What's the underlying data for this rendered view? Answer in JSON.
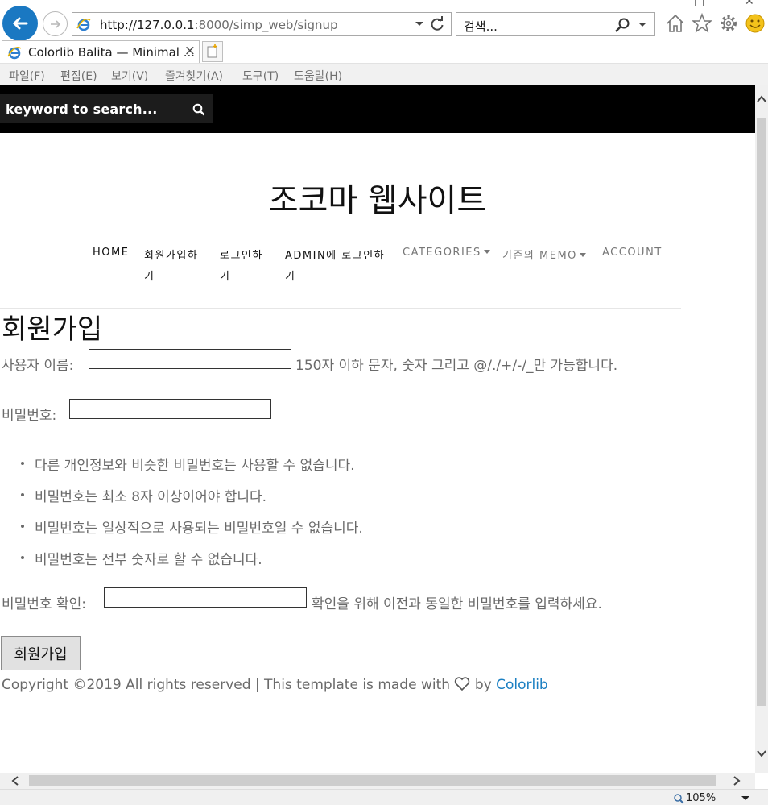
{
  "browser": {
    "url_host": "http://127.0.0.1",
    "url_rest": ":8000/simp_web/signup",
    "search_placeholder": "검색...",
    "tab_title": "Colorlib Balita — Minimal ...",
    "tab_close": "×",
    "menu": [
      "파일(F)",
      "편집(E)",
      "보기(V)",
      "즐겨찾기(A)",
      "도구(T)",
      "도움말(H)"
    ],
    "zoom": "105%"
  },
  "topbar": {
    "search_placeholder": "keyword to search..."
  },
  "site": {
    "title": "조코마 웹사이트"
  },
  "nav": {
    "home": "HOME",
    "signup_1": "회원가입하",
    "signup_2": "기",
    "login_1": "로그인하",
    "login_2": "기",
    "admin_1": "ADMIN에 로그인하",
    "admin_2": "기",
    "categories": "CATEGORIES",
    "memo": "기존의 MEMO",
    "account": "ACCOUNT"
  },
  "form": {
    "heading": "회원가입",
    "username_label": "사용자 이름:",
    "username_help": "150자 이하 문자, 숫자 그리고 @/./+/-/_만 가능합니다.",
    "password_label": "비밀번호:",
    "password_rules": [
      "다른 개인정보와 비슷한 비밀번호는 사용할 수 없습니다.",
      "비밀번호는 최소 8자 이상이어야 합니다.",
      "비밀번호는 일상적으로 사용되는 비밀번호일 수 없습니다.",
      "비밀번호는 전부 숫자로 할 수 없습니다."
    ],
    "confirm_label": "비밀번호 확인:",
    "confirm_help": "확인을 위해 이전과 동일한 비밀번호를 입력하세요.",
    "submit": "회원가입"
  },
  "footer": {
    "text_before": "Copyright ©2019 All rights reserved | This template is made with",
    "by": "by",
    "link": "Colorlib"
  }
}
